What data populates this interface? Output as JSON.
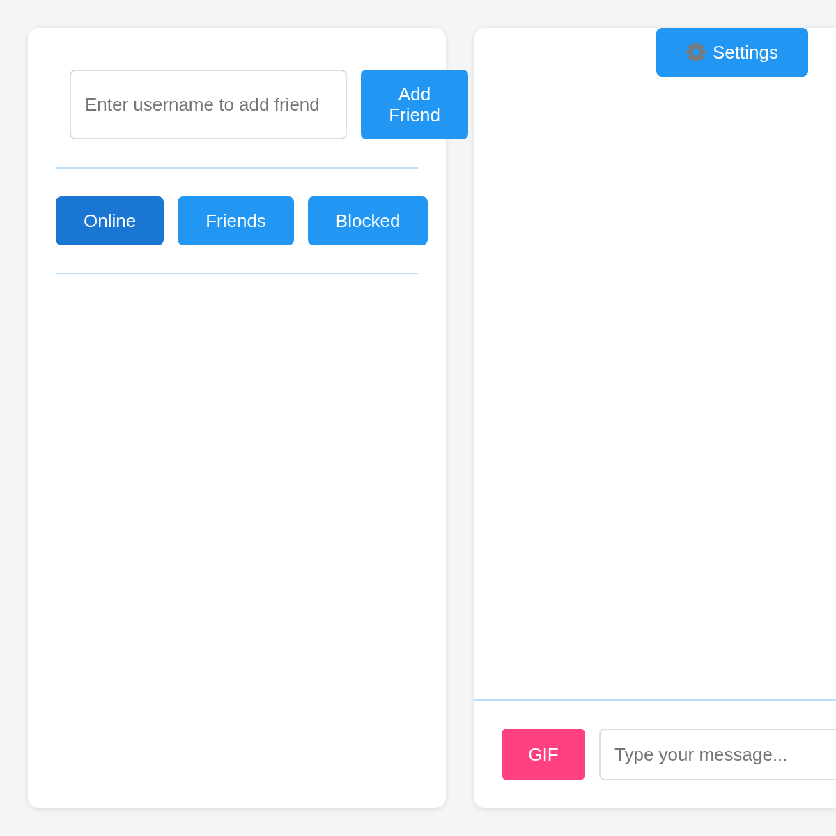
{
  "add_friend": {
    "placeholder": "Enter username to add friend",
    "button": "Add Friend"
  },
  "tabs": [
    {
      "label": "Online",
      "selected": true
    },
    {
      "label": "Friends",
      "selected": false
    },
    {
      "label": "Blocked",
      "selected": false
    }
  ],
  "settings_button": {
    "label": "Settings"
  },
  "composer": {
    "gif_button": "GIF",
    "placeholder": "Type your message..."
  }
}
